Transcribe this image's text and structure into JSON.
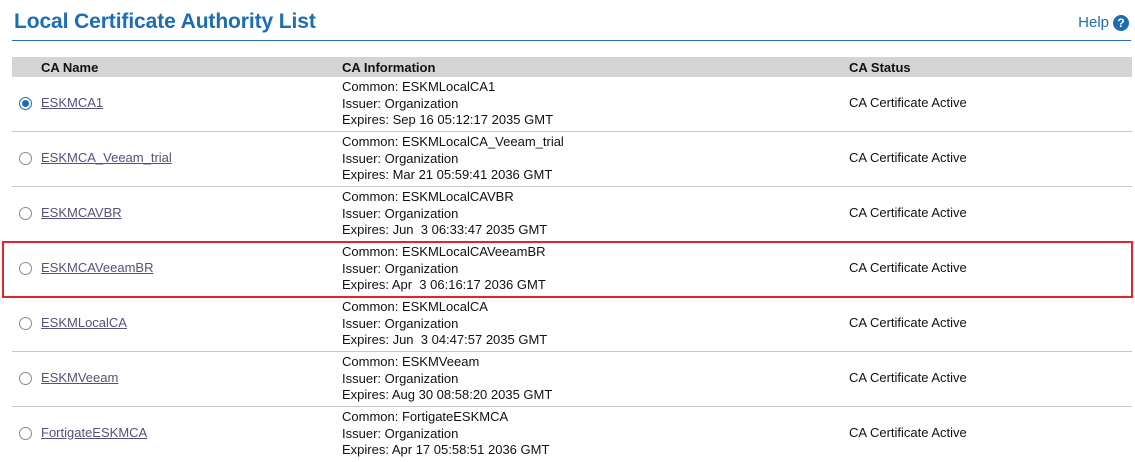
{
  "header": {
    "title": "Local Certificate Authority List",
    "help_label": "Help",
    "help_icon": "?"
  },
  "table": {
    "columns": [
      "CA Name",
      "CA Information",
      "CA Status"
    ],
    "rows": [
      {
        "name": "ESKMCA1",
        "selected": true,
        "common": "Common: ESKMLocalCA1",
        "issuer": "Issuer: Organization",
        "expires": "Expires: Sep 16 05:12:17 2035 GMT",
        "status": "CA Certificate Active"
      },
      {
        "name": "ESKMCA_Veeam_trial",
        "selected": false,
        "common": "Common: ESKMLocalCA_Veeam_trial",
        "issuer": "Issuer: Organization",
        "expires": "Expires: Mar 21 05:59:41 2036 GMT",
        "status": "CA Certificate Active"
      },
      {
        "name": "ESKMCAVBR",
        "selected": false,
        "common": "Common: ESKMLocalCAVBR",
        "issuer": "Issuer: Organization",
        "expires": "Expires: Jun  3 06:33:47 2035 GMT",
        "status": "CA Certificate Active"
      },
      {
        "name": "ESKMCAVeeamBR",
        "selected": false,
        "common": "Common: ESKMLocalCAVeeamBR",
        "issuer": "Issuer: Organization",
        "expires": "Expires: Apr  3 06:16:17 2036 GMT",
        "status": "CA Certificate Active"
      },
      {
        "name": "ESKMLocalCA",
        "selected": false,
        "common": "Common: ESKMLocalCA",
        "issuer": "Issuer: Organization",
        "expires": "Expires: Jun  3 04:47:57 2035 GMT",
        "status": "CA Certificate Active"
      },
      {
        "name": "ESKMVeeam",
        "selected": false,
        "common": "Common: ESKMVeeam",
        "issuer": "Issuer: Organization",
        "expires": "Expires: Aug 30 08:58:20 2035 GMT",
        "status": "CA Certificate Active"
      },
      {
        "name": "FortigateESKMCA",
        "selected": false,
        "common": "Common: FortigateESKMCA",
        "issuer": "Issuer: Organization",
        "expires": "Expires: Apr 17 05:58:51 2036 GMT",
        "status": "CA Certificate Active"
      }
    ]
  },
  "colors": {
    "title": "#1d6db3",
    "link": "#5a4f7a",
    "header_bg": "#d4d4d4",
    "highlight": "#e0262b"
  }
}
